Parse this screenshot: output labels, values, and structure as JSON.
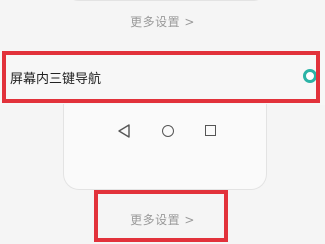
{
  "top_section": {
    "more_settings_label": "更多设置 >"
  },
  "nav_option": {
    "label": "屏幕内三键导航",
    "selected": true,
    "accent_color": "#2bb3a6"
  },
  "nav_preview": {
    "icons": [
      "back-triangle-icon",
      "home-circle-icon",
      "recent-square-icon"
    ]
  },
  "bottom_section": {
    "more_settings_label": "更多设置 >"
  },
  "highlight_color": "#e2323b"
}
